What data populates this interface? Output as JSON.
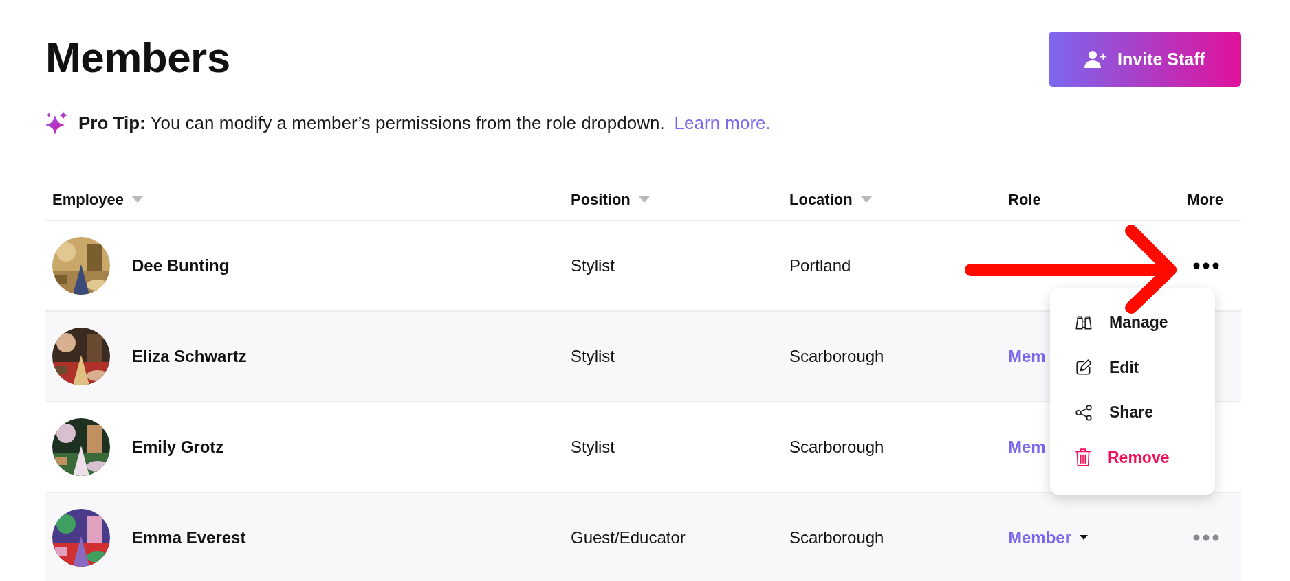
{
  "page": {
    "title": "Members"
  },
  "invite_button": {
    "label": "Invite Staff"
  },
  "pro_tip": {
    "text": "**Pro Tip:** You can modify a member’s permissions from the role dropdown.",
    "link": "Learn more."
  },
  "table": {
    "columns": [
      {
        "label": "Employee",
        "sortable": true
      },
      {
        "label": "Position",
        "sortable": true
      },
      {
        "label": "Location",
        "sortable": true
      },
      {
        "label": "Role",
        "sortable": false
      },
      {
        "label": "More",
        "sortable": false
      }
    ],
    "rows": [
      {
        "name": "Dee Bunting",
        "position": "Stylist",
        "location": "Portland",
        "more": {
          "active": true
        }
      },
      {
        "name": "Eliza Schwartz",
        "position": "Stylist",
        "location": "Scarborough",
        "role": {
          "text": "Mem",
          "caret": false
        }
      },
      {
        "name": "Emily Grotz",
        "position": "Stylist",
        "location": "Scarborough",
        "role": {
          "text": "Mem",
          "caret": false
        }
      },
      {
        "name": "Emma Everest",
        "position": "Guest/Educator",
        "location": "Scarborough",
        "role": {
          "text": "Member",
          "caret": true
        },
        "more": {
          "active": false
        }
      }
    ]
  },
  "action_menu": {
    "items": [
      {
        "kind": "manage",
        "label": "Manage",
        "danger": false
      },
      {
        "kind": "edit",
        "label": "Edit",
        "danger": false
      },
      {
        "kind": "share",
        "label": "Share",
        "danger": false
      },
      {
        "kind": "remove",
        "label": "Remove",
        "danger": true
      }
    ]
  },
  "annotation": {
    "kind": "arrow"
  }
}
